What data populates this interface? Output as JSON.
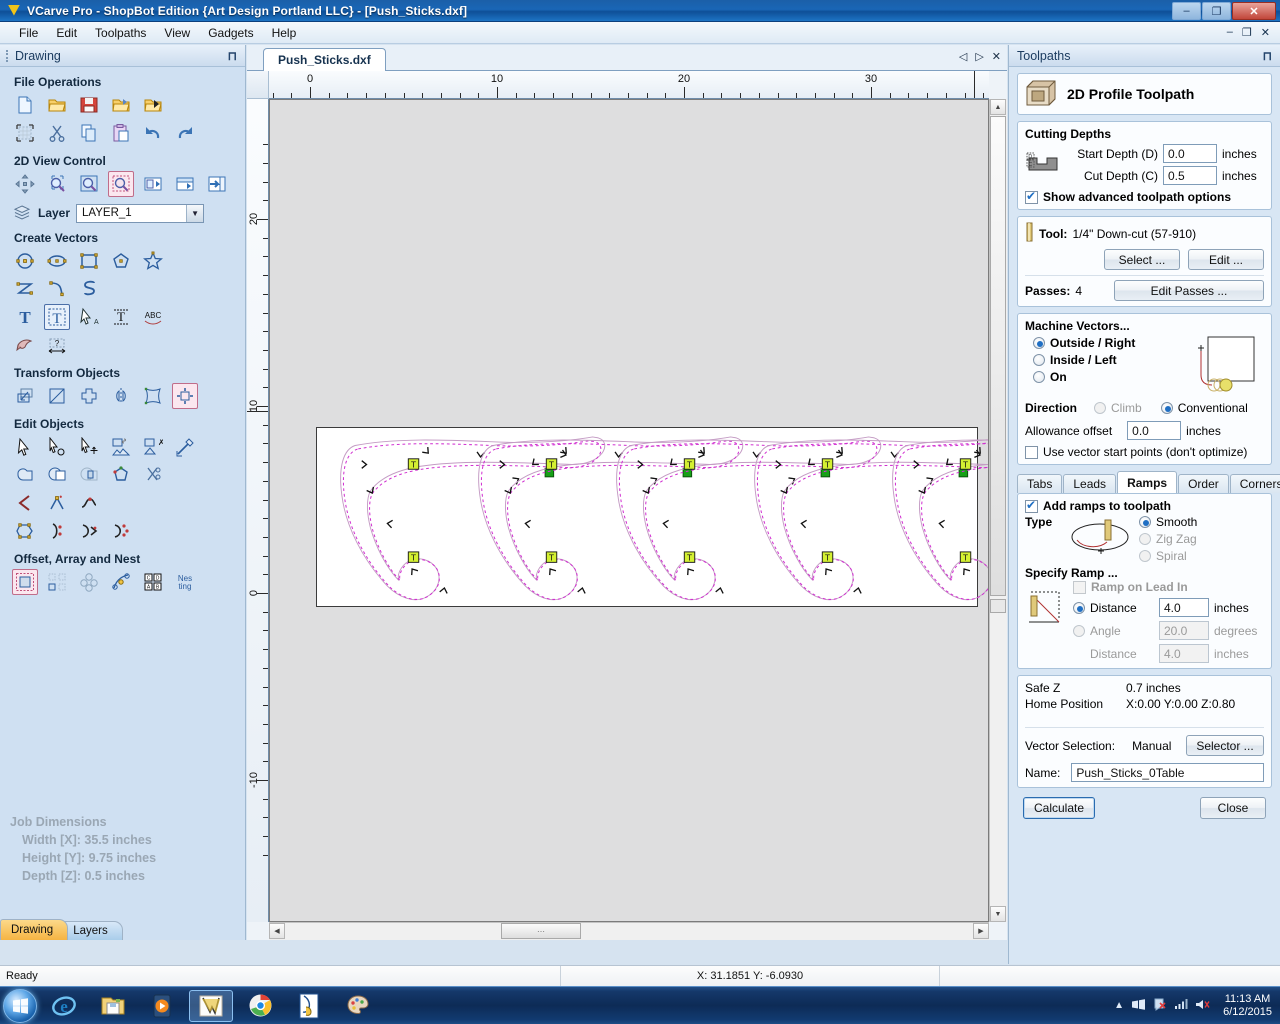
{
  "window": {
    "title": "VCarve Pro - ShopBot Edition {Art Design Portland LLC} - [Push_Sticks.dxf]",
    "logo_icon": "vcarve-logo-icon",
    "minimize": "–",
    "maximize": "❐",
    "close": "✕"
  },
  "menu": {
    "items": [
      "File",
      "Edit",
      "Toolpaths",
      "View",
      "Gadgets",
      "Help"
    ]
  },
  "left_dock": {
    "title": "Drawing",
    "pin_icon": "pin-icon",
    "sections": [
      {
        "title": "File Operations",
        "rows": [
          [
            "new-file-icon",
            "open-file-icon",
            "save-file-icon",
            "open-recent-icon",
            "import-file-icon"
          ],
          [
            "job-setup-icon",
            "cut-icon",
            "copy-icon",
            "paste-icon",
            "undo-icon",
            "redo-icon"
          ]
        ]
      },
      {
        "title": "2D View Control",
        "rows": [
          [
            "pan-icon",
            "zoom-interactive-icon",
            "zoom-extents-icon",
            "zoom-box-icon",
            "zoom-drawing-icon",
            "zoom-selection-icon",
            "toggle-panel-icon"
          ]
        ]
      },
      {
        "title": "Create Vectors",
        "rows": [
          [
            "circle-icon",
            "ellipse-icon",
            "rectangle-icon",
            "polygon-icon",
            "star-icon"
          ],
          [
            "polyline-icon",
            "curve-icon",
            "freehand-icon"
          ],
          [
            "text-icon",
            "text-box-icon",
            "text-select-icon",
            "text-on-curve-icon",
            "text-arc-icon"
          ],
          [
            "trace-bitmap-icon",
            "dimension-icon"
          ]
        ]
      },
      {
        "title": "Transform Objects",
        "rows": [
          [
            "move-icon",
            "scale-icon",
            "rotate-icon",
            "mirror-icon",
            "distort-icon",
            "align-icon"
          ]
        ]
      },
      {
        "title": "Edit Objects",
        "rows": [
          [
            "select-arrow-icon",
            "node-edit-icon",
            "move-nodes-icon",
            "group-icon",
            "ungroup-icon",
            "measure-icon"
          ],
          [
            "weld-icon",
            "subtract-icon",
            "intersect-icon",
            "join-vectors-icon",
            "trim-icon"
          ],
          [
            "close-vector-icon",
            "insert-node-icon",
            "smooth-node-icon"
          ],
          [
            "fit-curve-icon",
            "break-vector-icon",
            "reverse-icon",
            "start-point-icon"
          ]
        ]
      },
      {
        "title": "Offset, Array and Nest",
        "rows": [
          [
            "offset-icon",
            "array-copy-icon",
            "rotate-copy-icon",
            "copy-along-curve-icon",
            "block-copy-icon",
            "nesting-icon"
          ]
        ]
      }
    ],
    "layer": {
      "label": "Layer",
      "icon": "layers-icon",
      "value": "LAYER_1",
      "arrow_icon": "chevron-down-icon"
    },
    "job_dimensions": {
      "title": "Job Dimensions",
      "lines": [
        "Width  [X]: 35.5 inches",
        "Height [Y]: 9.75 inches",
        "Depth  [Z]: 0.5 inches"
      ]
    },
    "tabs": [
      {
        "label": "Drawing",
        "active": true
      },
      {
        "label": "Layers",
        "active": false
      }
    ]
  },
  "mdi": {
    "document_tab": "Push_Sticks.dxf",
    "nav": {
      "prev_icon": "prev-tab-icon",
      "next_icon": "next-tab-icon",
      "close_icon": "close-document-icon"
    },
    "child_controls": {
      "minimize": "–",
      "restore": "❐",
      "close": "✕"
    },
    "ruler": {
      "h_labels": [
        "0",
        "10",
        "20",
        "30"
      ],
      "v_labels": [
        "20",
        "10",
        "0",
        "-10"
      ],
      "units": "inches"
    }
  },
  "toolpaths": {
    "title": "Toolpaths",
    "pin_icon": "pin-icon",
    "header": {
      "icon": "2d-profile-toolpath-icon",
      "title": "2D Profile Toolpath"
    },
    "cutting_depths": {
      "title": "Cutting Depths",
      "diagram_icon": "cut-depth-diagram-icon",
      "start_depth": {
        "label": "Start Depth (D)",
        "value": "0.0",
        "units": "inches"
      },
      "cut_depth": {
        "label": "Cut Depth (C)",
        "value": "0.5",
        "units": "inches"
      },
      "show_advanced": {
        "label": "Show advanced toolpath options",
        "checked": true
      }
    },
    "tool": {
      "icon": "endmill-icon",
      "label": "Tool:",
      "value": "1/4\" Down-cut (57-910)",
      "select_button": "Select ...",
      "edit_button": "Edit ...",
      "passes_label": "Passes:",
      "passes_value": "4",
      "edit_passes_button": "Edit Passes ..."
    },
    "machine_vectors": {
      "title": "Machine Vectors...",
      "options": [
        {
          "label": "Outside / Right",
          "selected": true
        },
        {
          "label": "Inside / Left",
          "selected": false
        },
        {
          "label": "On",
          "selected": false
        }
      ],
      "direction_label": "Direction",
      "direction_options": [
        {
          "label": "Climb",
          "selected": false
        },
        {
          "label": "Conventional",
          "selected": true
        }
      ],
      "allowance_label": "Allowance offset",
      "allowance_value": "0.0",
      "allowance_units": "inches",
      "start_points": {
        "label": "Use vector start points (don't optimize)",
        "checked": false
      },
      "preview_icon": "machine-vectors-preview-icon"
    },
    "tabs": [
      {
        "label": "Tabs",
        "active": false
      },
      {
        "label": "Leads",
        "active": false
      },
      {
        "label": "Ramps",
        "active": true
      },
      {
        "label": "Order",
        "active": false
      },
      {
        "label": "Corners",
        "active": false
      }
    ],
    "ramps": {
      "add_ramps": {
        "label": "Add ramps to toolpath",
        "checked": true
      },
      "type_label": "Type",
      "type_icon": "ramp-type-diagram-icon",
      "type_options": [
        {
          "label": "Smooth",
          "selected": true
        },
        {
          "label": "Zig Zag",
          "selected": false
        },
        {
          "label": "Spiral",
          "selected": false
        }
      ],
      "specify_label": "Specify Ramp ...",
      "specify_icon": "ramp-specify-diagram-icon",
      "ramp_on_lead_in": {
        "label": "Ramp on Lead In",
        "checked": false,
        "disabled": true
      },
      "distance": {
        "label": "Distance",
        "selected": true,
        "value": "4.0",
        "units": "inches"
      },
      "angle": {
        "label": "Angle",
        "selected": false,
        "value": "20.0",
        "units": "degrees"
      },
      "angle_distance": {
        "label": "Distance",
        "value": "4.0",
        "units": "inches"
      }
    },
    "footer": {
      "safe_z_label": "Safe Z",
      "safe_z_value": "0.7 inches",
      "home_label": "Home Position",
      "home_value": "X:0.00 Y:0.00 Z:0.80",
      "vector_selection_label": "Vector Selection:",
      "vector_selection_value": "Manual",
      "selector_button": "Selector ...",
      "name_label": "Name:",
      "name_value": "Push_Sticks_0Table"
    },
    "actions": {
      "calculate": "Calculate",
      "close": "Close"
    }
  },
  "status_bar": {
    "message": "Ready",
    "coordinates": "X: 31.1851 Y: -6.0930"
  },
  "taskbar": {
    "start_icon": "windows-start-icon",
    "items": [
      "internet-explorer-icon",
      "file-explorer-icon",
      "media-player-icon",
      "vcarve-pro-icon",
      "google-chrome-icon",
      "partworks-icon",
      "paint-icon"
    ],
    "tray": [
      "show-hidden-icons-icon",
      "network-icon",
      "action-center-icon",
      "signal-icon",
      "volume-muted-icon"
    ],
    "clock_time": "11:13 AM",
    "clock_date": "6/12/2015"
  }
}
